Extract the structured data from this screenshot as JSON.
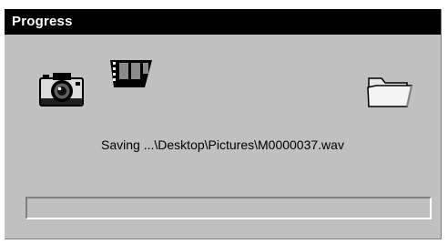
{
  "window": {
    "title": "Progress"
  },
  "status": {
    "text": "Saving ...\\Desktop\\Pictures\\M0000037.wav"
  },
  "progress": {
    "fraction": 0
  },
  "icons": {
    "source": "camera-icon",
    "animation": "film-strip-icon",
    "destination": "folder-icon"
  },
  "colors": {
    "titlebar": "#000000",
    "title_text": "#ffffff",
    "dialog_background": "#c0c0c0",
    "progress_fill": "#000080"
  }
}
